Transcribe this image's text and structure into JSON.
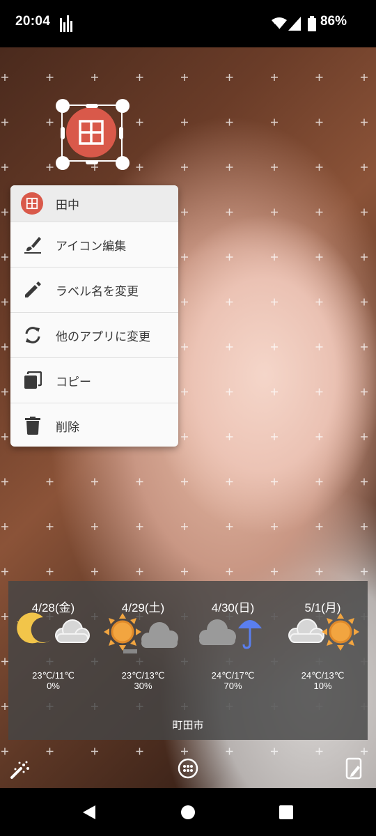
{
  "status": {
    "time": "20:04",
    "battery": "86%"
  },
  "app_icon": {
    "glyph": "田",
    "color": "#d9594a"
  },
  "menu": {
    "header_label": "田中",
    "items": [
      {
        "label": "アイコン編集",
        "icon": "brush-icon"
      },
      {
        "label": "ラベル名を変更",
        "icon": "pencil-icon"
      },
      {
        "label": "他のアプリに変更",
        "icon": "swap-icon"
      },
      {
        "label": "コピー",
        "icon": "copy-icon"
      },
      {
        "label": "削除",
        "icon": "trash-icon"
      }
    ]
  },
  "weather": {
    "days": [
      {
        "date": "4/28(金)",
        "temp": "23℃/11℃",
        "pop": "0%",
        "icon": "moon-cloud-icon"
      },
      {
        "date": "4/29(土)",
        "temp": "23℃/13℃",
        "pop": "30%",
        "icon": "sun-cloud-icon"
      },
      {
        "date": "4/30(日)",
        "temp": "24℃/17℃",
        "pop": "70%",
        "icon": "cloud-umbrella-icon"
      },
      {
        "date": "5/1(月)",
        "temp": "24℃/13℃",
        "pop": "10%",
        "icon": "cloud-sun-icon"
      }
    ],
    "city": "町田市"
  }
}
